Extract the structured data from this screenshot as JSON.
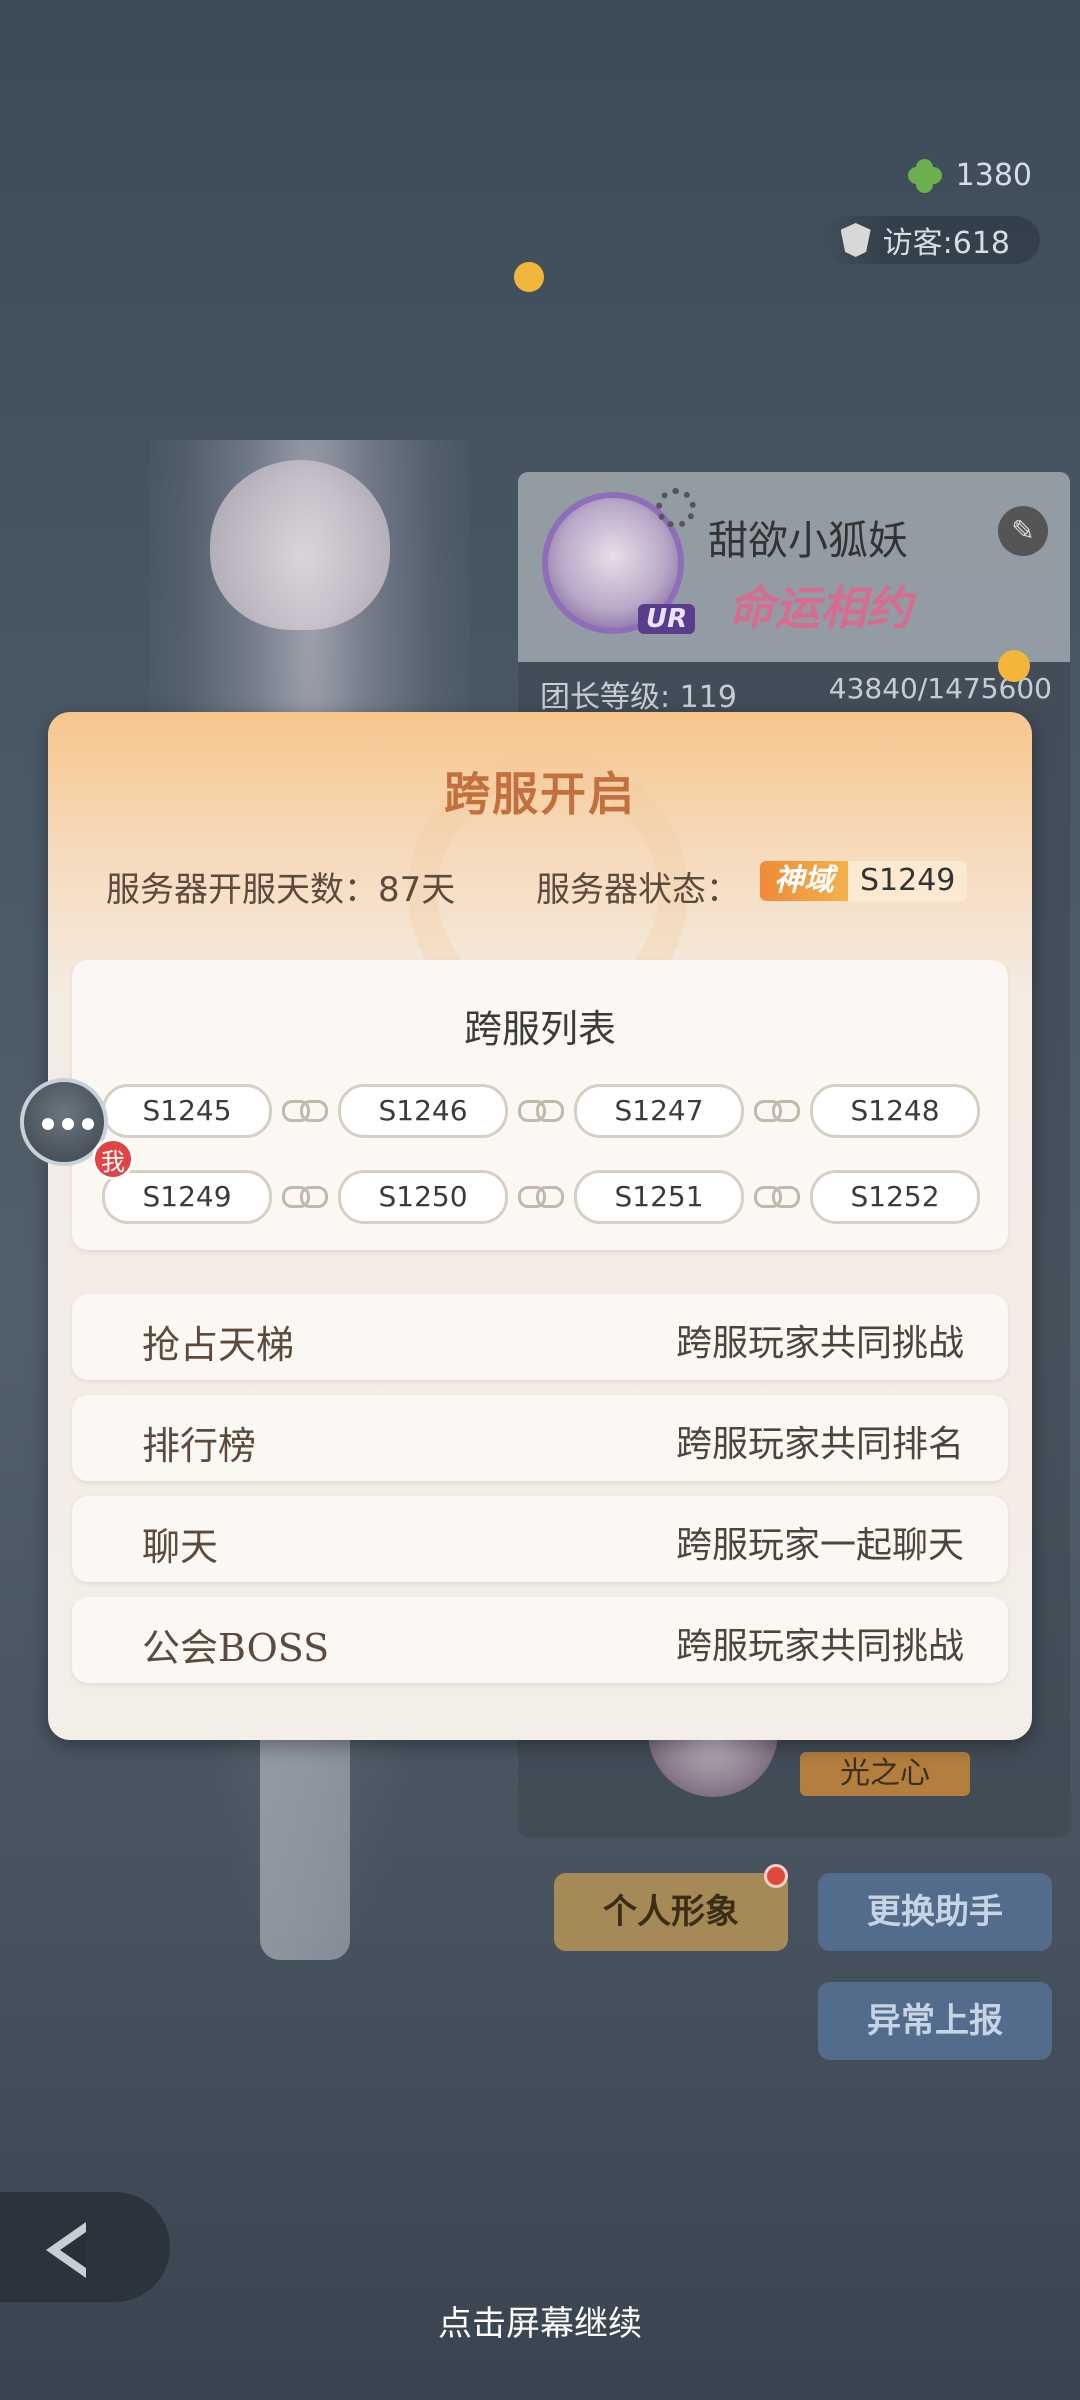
{
  "background": {
    "clover_count": "1380",
    "visitors": "访客:618",
    "profile": {
      "name": "甜欲小狐妖",
      "title": "命运相约",
      "rarity": "UR",
      "level_label": "团长等级: 119",
      "exp": "43840/1475600",
      "helper_tag": "光之心"
    },
    "buttons": {
      "persona": "个人形象",
      "change_helper": "更换助手",
      "report": "异常上报"
    },
    "continue_hint": "点击屏幕继续"
  },
  "modal": {
    "title": "跨服开启",
    "open_days": "服务器开服天数：87天",
    "status_label": "服务器状态：",
    "status_badge": "神域",
    "current_server": "S1249",
    "list_title": "跨服列表",
    "servers_row1": [
      "S1245",
      "S1246",
      "S1247",
      "S1248"
    ],
    "servers_row2": [
      "S1249",
      "S1250",
      "S1251",
      "S1252"
    ],
    "features": [
      {
        "name": "抢占天梯",
        "desc": "跨服玩家共同挑战"
      },
      {
        "name": "排行榜",
        "desc": "跨服玩家共同排名"
      },
      {
        "name": "聊天",
        "desc": "跨服玩家一起聊天"
      },
      {
        "name": "公会BOSS",
        "desc": "跨服玩家共同挑战"
      }
    ]
  },
  "me_badge": "我",
  "colors": {
    "accent_title": "#c36f3e",
    "status_gradient": "#f08a3a"
  }
}
